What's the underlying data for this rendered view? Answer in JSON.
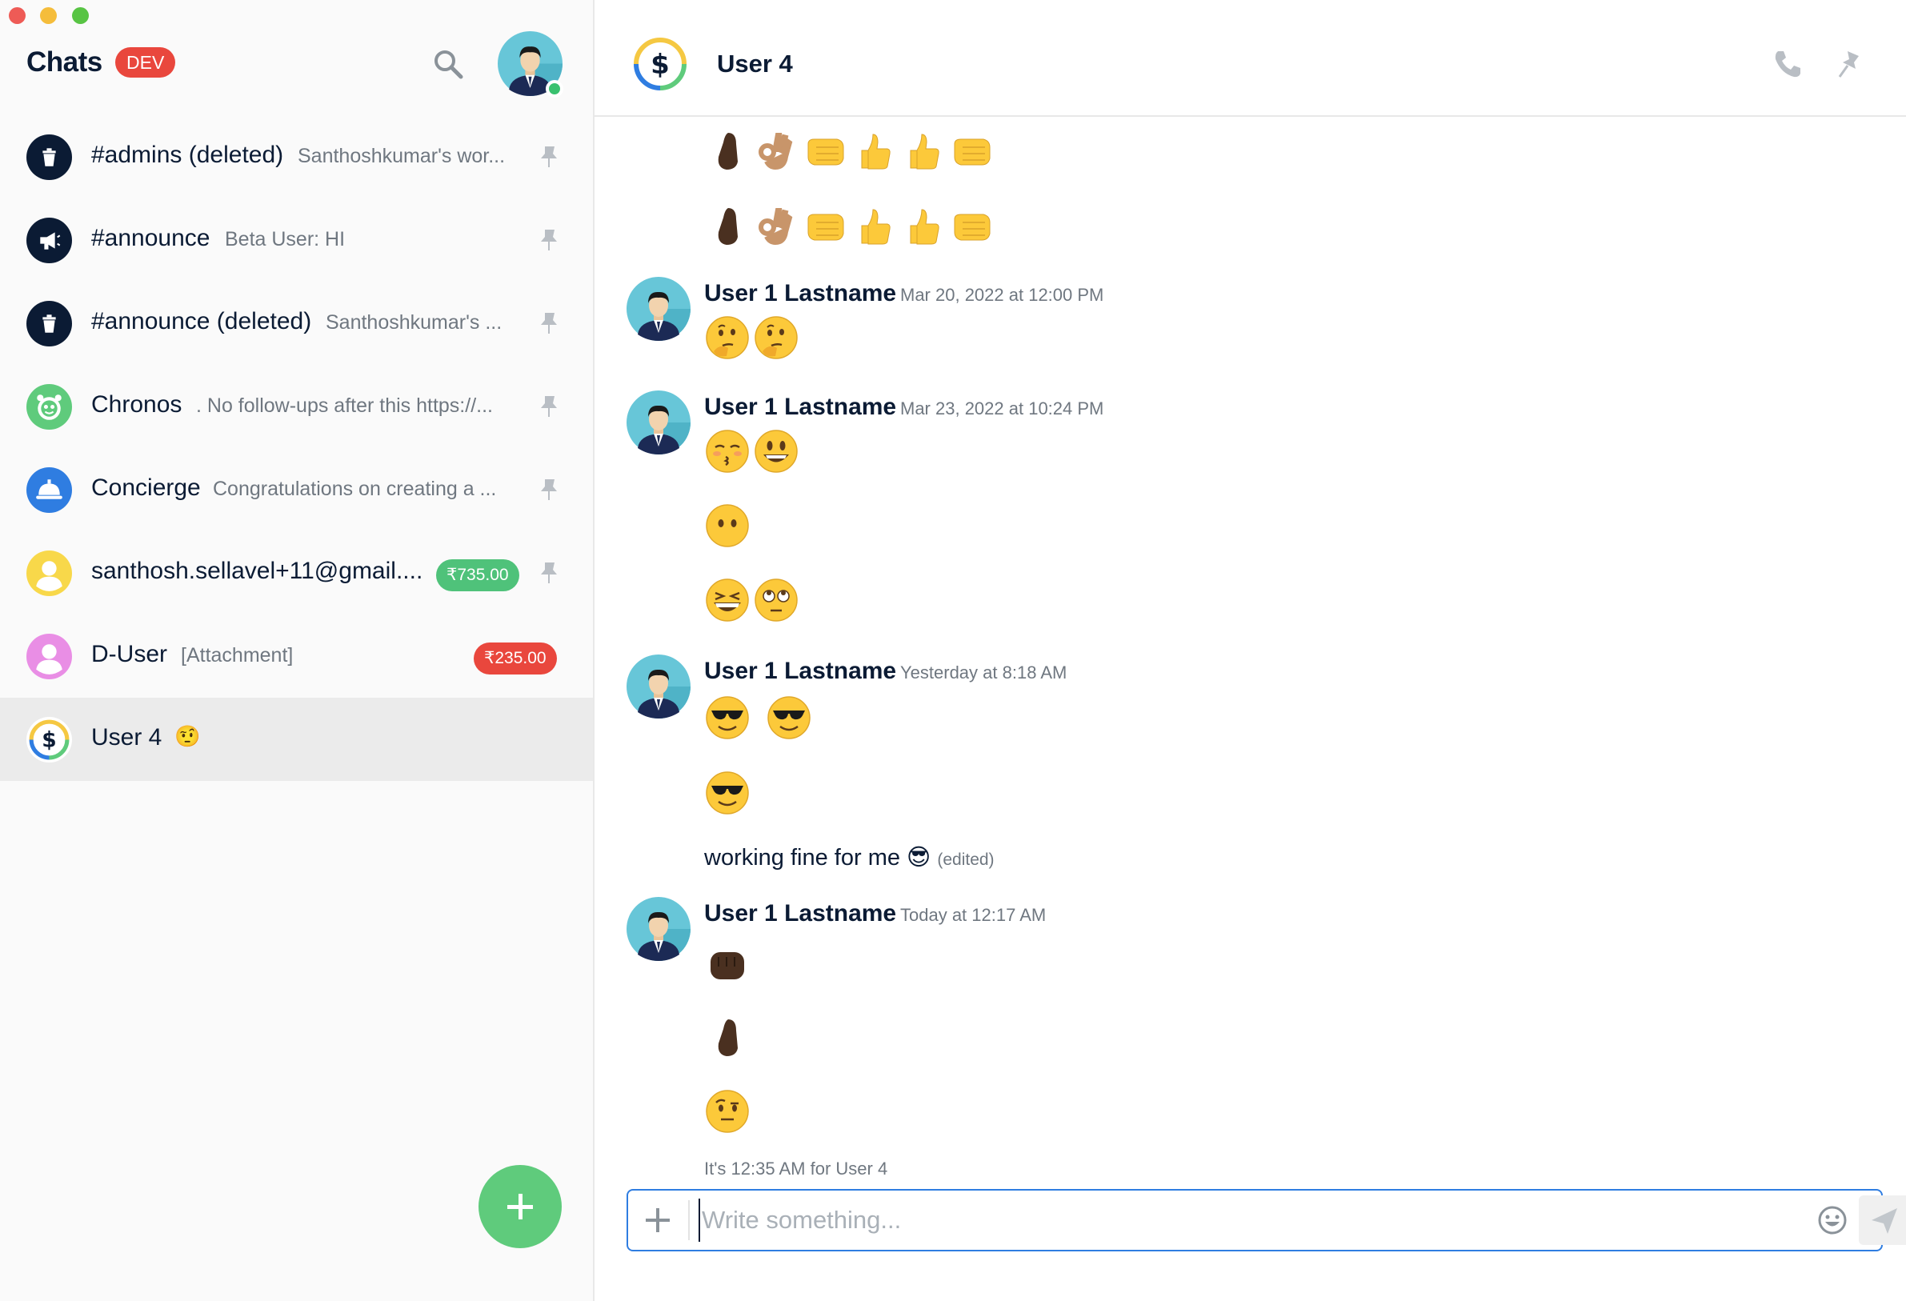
{
  "sidebar": {
    "title": "Chats",
    "env_badge": "DEV",
    "icons": {
      "search": "search-icon",
      "new_chat": "plus-icon",
      "pin": "pin-icon"
    },
    "items": [
      {
        "name": "#admins (deleted)",
        "preview": "Santhoshkumar's wor...",
        "avatar": "trash-icon",
        "pinned": true
      },
      {
        "name": "#announce",
        "preview": "Beta User: HI",
        "avatar": "megaphone-icon",
        "pinned": true
      },
      {
        "name": "#announce (deleted)",
        "preview": "Santhoshkumar's ...",
        "avatar": "trash-icon",
        "pinned": true
      },
      {
        "name": "Chronos",
        "preview": ". No follow-ups after this https://...",
        "avatar": "chronos-icon",
        "pinned": true
      },
      {
        "name": "Concierge",
        "preview": "Congratulations on creating a ...",
        "avatar": "concierge-bell-icon",
        "pinned": true
      },
      {
        "name": "santhosh.sellavel+11@gmail....",
        "preview": "",
        "badge": "₹735.00",
        "badge_color": "#4fc27a",
        "avatar": "default-user-icon",
        "pinned": true
      },
      {
        "name": "D-User",
        "preview": "[Attachment]",
        "badge": "₹235.00",
        "badge_color": "#e9473d",
        "avatar": "default-user-icon",
        "pinned": false
      },
      {
        "name": "User 4",
        "preview": "🤨",
        "avatar": "dollar-icon",
        "pinned": false,
        "active": true
      }
    ]
  },
  "header": {
    "title": "User 4"
  },
  "messages": {
    "groups": [
      {
        "author": "User 1 Lastname",
        "time": "Mar 20, 2022 at 12:00 PM"
      },
      {
        "author": "User 1 Lastname",
        "time": "Mar 23, 2022 at 10:24 PM"
      },
      {
        "author": "User 1 Lastname",
        "time": "Yesterday at 8:18 AM"
      },
      {
        "author": "User 1 Lastname",
        "time": "Today at 12:17 AM"
      }
    ],
    "text_message": "working fine for me 😎",
    "edited_label": "(edited)",
    "emoji_lines": [
      [
        "pinched-fingers-dark",
        "ok-hand-medium",
        "left-facing-fist",
        "thumbs-up",
        "thumbs-up",
        "left-facing-fist"
      ],
      [
        "pinched-fingers-dark",
        "ok-hand-medium",
        "left-facing-fist",
        "thumbs-up",
        "thumbs-up",
        "left-facing-fist"
      ],
      [
        "thinking-face",
        "thinking-face"
      ],
      [
        "kissing-face",
        "grinning-face"
      ],
      [
        "face-without-mouth"
      ],
      [
        "grinning-squinting-face",
        "face-with-rolling-eyes"
      ],
      [
        "smiling-face-sunglasses",
        "smiling-face-sunglasses"
      ],
      [
        "smiling-face-sunglasses"
      ],
      [
        "oncoming-fist-dark"
      ],
      [
        "pinched-fingers-dark"
      ],
      [
        "face-raised-eyebrow"
      ]
    ]
  },
  "footer": {
    "local_time": "It's 12:35 AM for User 4",
    "composer_placeholder": "Write something..."
  },
  "colors": {
    "accent_green": "#5fcb7c",
    "badge_red": "#e9473d",
    "composer_border": "#2f7de1"
  }
}
